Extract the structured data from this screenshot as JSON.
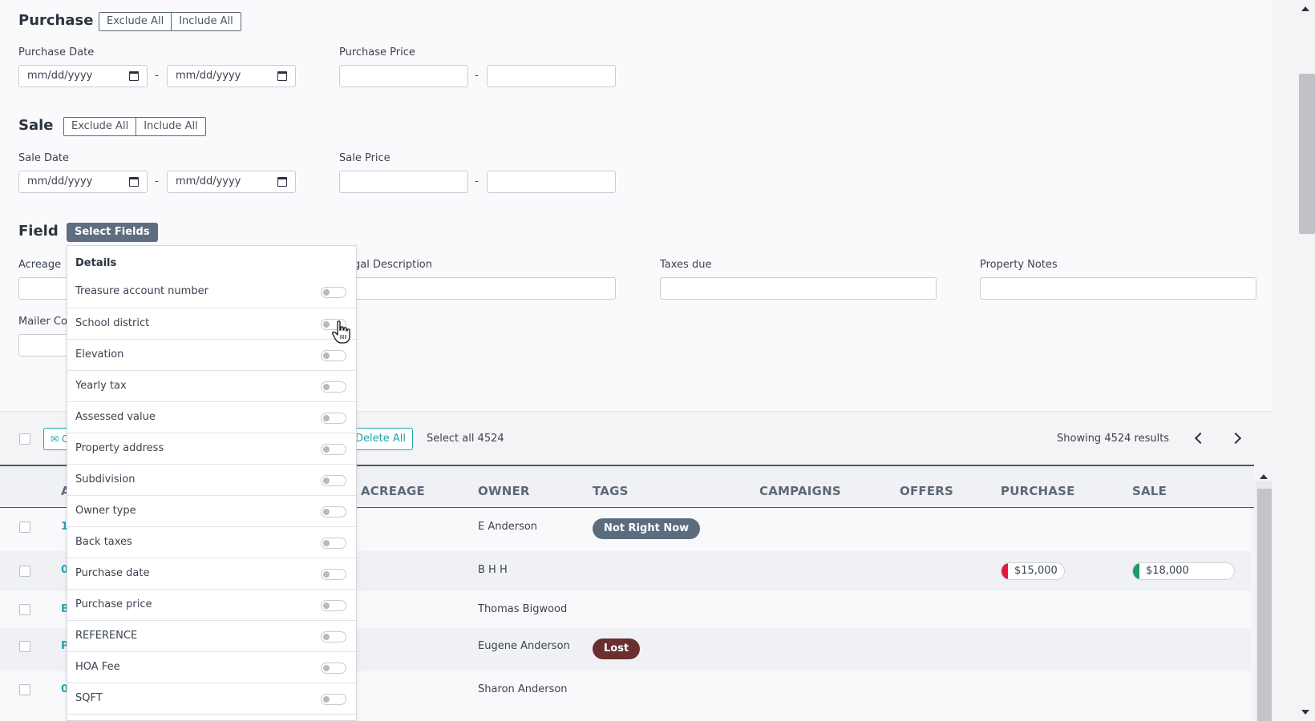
{
  "purchase": {
    "title": "Purchase",
    "exclude_all": "Exclude All",
    "include_all": "Include All",
    "date_label": "Purchase Date",
    "price_label": "Purchase Price",
    "date_placeholder": "mm/dd/yyyy",
    "separator": "-"
  },
  "sale": {
    "title": "Sale",
    "exclude_all": "Exclude All",
    "include_all": "Include All",
    "date_label": "Sale Date",
    "price_label": "Sale Price",
    "date_placeholder": "mm/dd/yyyy",
    "separator": "-"
  },
  "field": {
    "title": "Field",
    "select_fields": "Select Fields",
    "acreage_label": "Acreage",
    "legal_description_label": "gal Description",
    "taxes_due_label": "Taxes due",
    "property_notes_label": "Property Notes",
    "mailer_label": "Mailer Co"
  },
  "dropdown": {
    "header": "Details",
    "items": [
      {
        "label": "Treasure account number",
        "enabled": false
      },
      {
        "label": "School district",
        "enabled": false
      },
      {
        "label": "Elevation",
        "enabled": false
      },
      {
        "label": "Yearly tax",
        "enabled": false
      },
      {
        "label": "Assessed value",
        "enabled": false
      },
      {
        "label": "Property address",
        "enabled": false
      },
      {
        "label": "Subdivision",
        "enabled": false
      },
      {
        "label": "Owner type",
        "enabled": false
      },
      {
        "label": "Back taxes",
        "enabled": false
      },
      {
        "label": "Purchase date",
        "enabled": false
      },
      {
        "label": "Purchase price",
        "enabled": false
      },
      {
        "label": "REFERENCE",
        "enabled": false
      },
      {
        "label": "HOA Fee",
        "enabled": false
      },
      {
        "label": "SQFT",
        "enabled": false
      }
    ]
  },
  "toolbar": {
    "mail_label": "C",
    "delete_all": "Delete All",
    "select_all": "Select all 4524",
    "showing": "Showing 4524 results"
  },
  "table": {
    "headers": {
      "a": "A",
      "acreage": "ACREAGE",
      "owner": "OWNER",
      "tags": "TAGS",
      "campaigns": "CAMPAIGNS",
      "offers": "OFFERS",
      "purchase": "PURCHASE",
      "sale": "SALE"
    },
    "rows": [
      {
        "id_fragment": "1",
        "owner": "E Anderson",
        "tag": "Not Right Now",
        "purchase": "",
        "sale": ""
      },
      {
        "id_fragment": "0",
        "owner": "B H H",
        "tag": "",
        "purchase": "$15,000",
        "sale": "$18,000"
      },
      {
        "id_fragment": "B",
        "owner": "Thomas Bigwood",
        "tag": "",
        "purchase": "",
        "sale": ""
      },
      {
        "id_fragment": "P",
        "owner": "Eugene Anderson",
        "tag": "Lost",
        "purchase": "",
        "sale": ""
      },
      {
        "id_fragment": "0",
        "owner": "Sharon Anderson",
        "tag": "",
        "purchase": "",
        "sale": ""
      }
    ]
  },
  "colors": {
    "tag_not_right_now": "#5a6c7e",
    "tag_lost": "#6b2f2f",
    "purchase_bar": "#e0193c",
    "sale_bar": "#1e9b6a",
    "link_teal": "#1fa5b0"
  }
}
